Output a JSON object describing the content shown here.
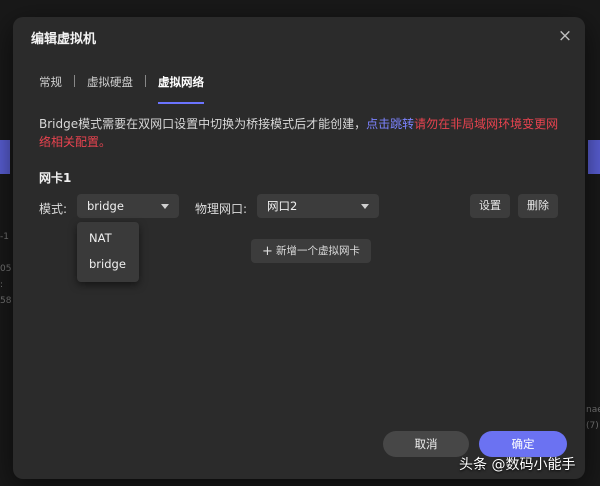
{
  "dialog": {
    "title": "编辑虚拟机",
    "close_icon": "×"
  },
  "tabs": [
    {
      "label": "常规",
      "active": false
    },
    {
      "label": "虚拟硬盘",
      "active": false
    },
    {
      "label": "虚拟网络",
      "active": true
    }
  ],
  "notice": {
    "text": "Bridge模式需要在双网口设置中切换为桥接模式后才能创建，",
    "link": "点击跳转",
    "warning": "请勿在非局域网环境变更网络相关配置。"
  },
  "nic": {
    "title": "网卡1",
    "mode_label": "模式:",
    "mode_value": "bridge",
    "mode_options": [
      "NAT",
      "bridge"
    ],
    "port_label": "物理网口:",
    "port_value": "网口2",
    "settings_button": "设置",
    "delete_button": "删除"
  },
  "add_nic_button": "新增一个虚拟网卡",
  "footer": {
    "cancel": "取消",
    "confirm": "确定"
  },
  "background_fragments": {
    "left": [
      "-1",
      "05",
      ":",
      "58"
    ],
    "right": [
      "nae",
      "(7)"
    ]
  },
  "watermark": "头条 @数码小能手",
  "colors": {
    "accent": "#6b72f2",
    "link": "#7c83ff",
    "warning": "#e8434f"
  }
}
